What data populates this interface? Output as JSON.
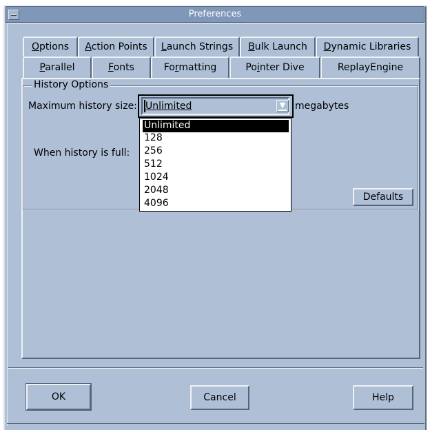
{
  "window": {
    "title": "Preferences"
  },
  "tabs_row1": [
    {
      "pre": "",
      "u": "O",
      "post": "ptions"
    },
    {
      "pre": "",
      "u": "A",
      "post": "ction Points"
    },
    {
      "pre": "",
      "u": "L",
      "post": "aunch Strings"
    },
    {
      "pre": "",
      "u": "B",
      "post": "ulk Launch"
    },
    {
      "pre": "",
      "u": "D",
      "post": "ynamic Libraries"
    }
  ],
  "tabs_row2": [
    {
      "pre": "",
      "u": "P",
      "post": "arallel"
    },
    {
      "pre": "",
      "u": "F",
      "post": "onts"
    },
    {
      "pre": "Fo",
      "u": "r",
      "post": "matting"
    },
    {
      "pre": "Po",
      "u": "i",
      "post": "nter Dive"
    },
    {
      "pre": "ReplayEngine",
      "u": "",
      "post": ""
    }
  ],
  "history": {
    "group_label": "History Options",
    "max_size_label": "Maximum history size:",
    "max_size_value": "Unlimited",
    "units": "megabytes",
    "when_full_label": "When history is full:",
    "options": [
      "Unlimited",
      "128",
      "256",
      "512",
      "1024",
      "2048",
      "4096"
    ],
    "selected_index": 0,
    "defaults_button": "Defaults"
  },
  "footer": {
    "ok": "OK",
    "cancel": "Cancel",
    "help": "Help"
  }
}
